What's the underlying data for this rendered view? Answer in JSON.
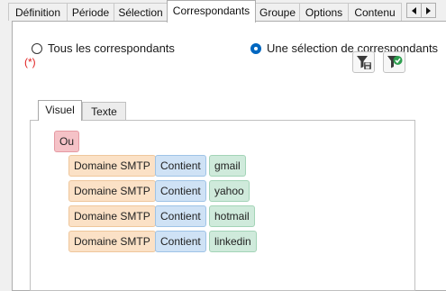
{
  "tabs": [
    {
      "label": "Définition",
      "active": false
    },
    {
      "label": "Période",
      "active": false
    },
    {
      "label": "Sélection",
      "active": false
    },
    {
      "label": "Correspondants",
      "active": true
    },
    {
      "label": "Groupe",
      "active": false
    },
    {
      "label": "Options",
      "active": false
    },
    {
      "label": "Contenu",
      "active": false
    }
  ],
  "tab_scroll": {
    "left_icon": "triangle-left-icon",
    "right_icon": "triangle-right-icon"
  },
  "recipients": {
    "option_all": "Tous les correspondants",
    "option_selection": "Une sélection de correspondants",
    "selected": "option_selection"
  },
  "required_marker": "(*)",
  "toolbar": {
    "filter_save_icon": "filter-save-icon",
    "filter_apply_icon": "filter-check-icon"
  },
  "editor_tabs": [
    {
      "label": "Visuel",
      "active": true
    },
    {
      "label": "Texte",
      "active": false
    }
  ],
  "rule": {
    "operator": "Ou",
    "conditions": [
      {
        "field": "Domaine SMTP",
        "comparator": "Contient",
        "value": "gmail"
      },
      {
        "field": "Domaine SMTP",
        "comparator": "Contient",
        "value": "yahoo"
      },
      {
        "field": "Domaine SMTP",
        "comparator": "Contient",
        "value": "hotmail"
      },
      {
        "field": "Domaine SMTP",
        "comparator": "Contient",
        "value": "linkedin"
      }
    ]
  },
  "colors": {
    "operator_chip": "#f5c2c7",
    "field_chip": "#fbe1c6",
    "comparator_chip": "#cfe2f5",
    "value_chip": "#cfeadb",
    "required": "#e02020",
    "radio_selected": "#0067c0"
  }
}
